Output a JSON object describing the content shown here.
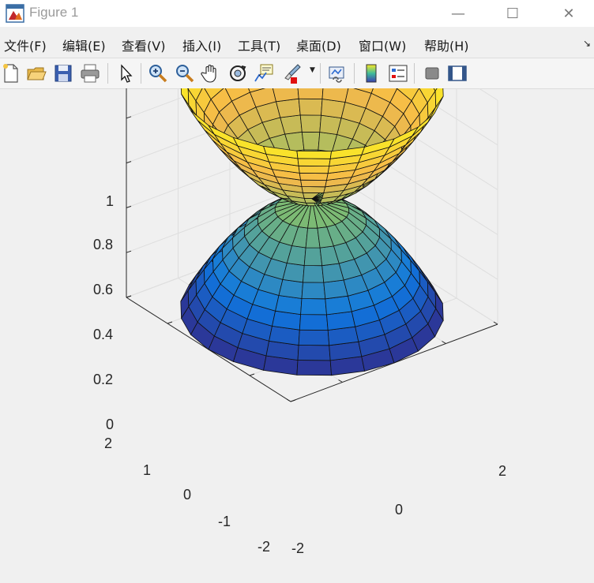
{
  "window": {
    "title": "Figure 1",
    "minimize_glyph": "—",
    "maximize_glyph": "☐",
    "close_glyph": "✕"
  },
  "menu": {
    "items": [
      "文件(F)",
      "编辑(E)",
      "查看(V)",
      "插入(I)",
      "工具(T)",
      "桌面(D)",
      "窗口(W)",
      "帮助(H)"
    ],
    "overflow_glyph": "↘"
  },
  "toolbar": {
    "buttons": [
      "new-figure-icon",
      "open-file-icon",
      "save-icon",
      "print-icon",
      "edit-plot-arrow-icon",
      "zoom-in-icon",
      "zoom-out-icon",
      "pan-hand-icon",
      "rotate-3d-icon",
      "data-cursor-icon",
      "brush-icon",
      "link-plot-icon",
      "colorbar-icon",
      "legend-icon",
      "hide-plot-tools-icon",
      "show-plot-tools-icon"
    ]
  },
  "plot": {
    "z_ticks": [
      "0",
      "0.2",
      "0.4",
      "0.6",
      "0.8",
      "1"
    ],
    "x_ticks": [
      "-2",
      "0",
      "2"
    ],
    "y_ticks": [
      "-2",
      "-1",
      "0",
      "1",
      "2"
    ],
    "colors": {
      "top_rim": "#f9e826",
      "top_mid": "#f6b84a",
      "neck": "#86c06a",
      "bottom_mid": "#0f77e0",
      "bottom_rim": "#2f2f8f"
    }
  }
}
